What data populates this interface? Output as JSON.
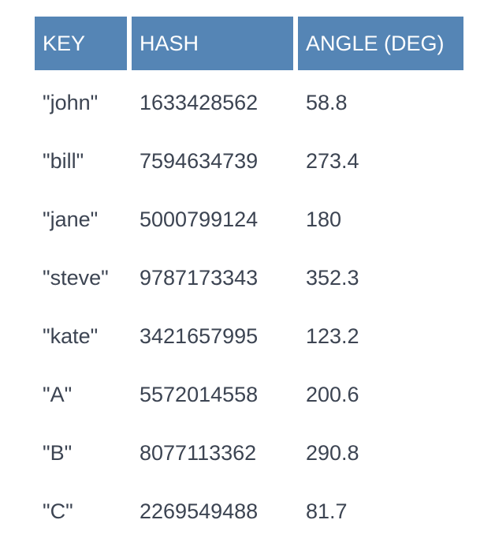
{
  "table": {
    "headers": [
      "KEY",
      "HASH",
      "ANGLE (DEG)"
    ],
    "rows": [
      [
        "\"john\"",
        "1633428562",
        "58.8"
      ],
      [
        "\"bill\"",
        "7594634739",
        "273.4"
      ],
      [
        "\"jane\"",
        "5000799124",
        "180"
      ],
      [
        "\"steve\"",
        "9787173343",
        "352.3"
      ],
      [
        "\"kate\"",
        "3421657995",
        "123.2"
      ],
      [
        "\"A\"",
        "5572014558",
        "200.6"
      ],
      [
        "\"B\"",
        "8077113362",
        "290.8"
      ],
      [
        "\"C\"",
        "2269549488",
        "81.7"
      ]
    ]
  },
  "colors": {
    "header_bg": "#5585b5",
    "header_text": "#ffffff",
    "cell_text": "#3c4452"
  }
}
